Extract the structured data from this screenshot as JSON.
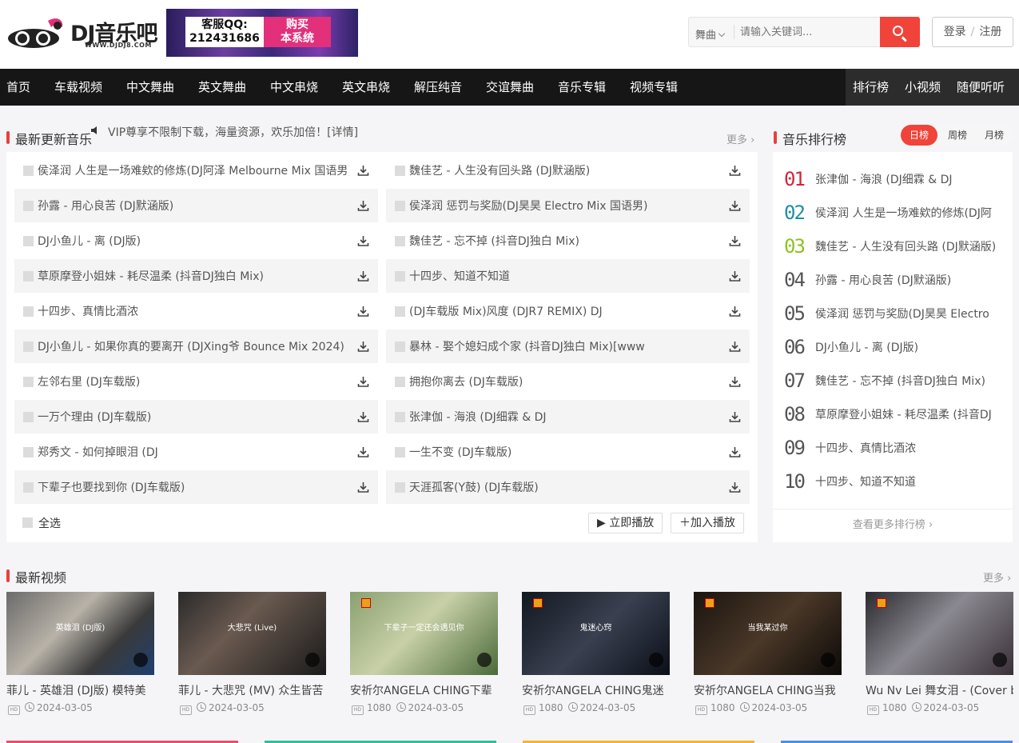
{
  "header": {
    "logo_text": "DJ音乐吧",
    "logo_sub": "WWW.DJDJ8.COM",
    "banner_qq_label": "客服QQ:",
    "banner_qq_number": "212431686",
    "banner_buy_line1": "购买",
    "banner_buy_line2": "本系统",
    "search_category": "舞曲",
    "search_placeholder": "请输入关键词...",
    "login_label": "登录",
    "login_sep": "/",
    "register_label": "注册"
  },
  "nav": {
    "items": [
      "首页",
      "车载视频",
      "中文舞曲",
      "英文舞曲",
      "中文串烧",
      "英文串烧",
      "解压纯音",
      "交谊舞曲",
      "音乐专辑",
      "视频专辑"
    ],
    "right_items": [
      "排行榜",
      "小视频",
      "随便听听"
    ]
  },
  "music": {
    "section_title": "最新更新音乐",
    "notice": "VIP尊享不限制下载，海量资源，欢乐加倍！[详情]",
    "more_label": "更多",
    "left": [
      "侯泽润 人生是一场难欸的修炼(DJ阿泽 Melbourne Mix 国语男)",
      "孙露 - 用心良苦 (DJ默涵版)",
      "DJ小鱼儿 - 离 (DJ版)",
      "草原摩登小姐妹 - 耗尽温柔 (抖音DJ独白 Mix)",
      "十四步、真情比酒浓",
      "DJ小鱼儿 - 如果你真的要离开 (DJXing爷 Bounce Mix 2024)",
      "左邻右里 (DJ车载版)",
      "一万个理由 (DJ车载版)",
      "郑秀文 - 如何掉眼泪 (DJ",
      "下辈子也要找到你 (DJ车载版)"
    ],
    "right": [
      "魏佳艺 - 人生没有回头路 (DJ默涵版)",
      "侯泽润 惩罚与奖励(DJ昊昊 Electro Mix 国语男)",
      "魏佳艺 - 忘不掉 (抖音DJ独白 Mix)",
      "十四步、知道不知道",
      "(DJ车载版 Mix)风度 (DJR7 REMIX) DJ",
      "暴林 - 娶个媳妇成个家 (抖音DJ独白 Mix)[www",
      "拥抱你离去 (DJ车载版)",
      "张津伽 - 海浪 (DJ细霖 & DJ",
      "一生不变 (DJ车载版)",
      "天涯孤客(Y鼓) (DJ车载版)"
    ],
    "select_all": "全选",
    "play_now": "▶ 立即播放",
    "add_play": "＋加入播放"
  },
  "rank": {
    "section_title": "音乐排行榜",
    "tabs": [
      "日榜",
      "周榜",
      "月榜"
    ],
    "active_tab": "日榜",
    "items": [
      {
        "num": "01",
        "name": "张津伽 - 海浪 (DJ细霖 & DJ",
        "color": "#d0263b"
      },
      {
        "num": "02",
        "name": "侯泽润 人生是一场难欸的修炼(DJ阿",
        "color": "#1f8fa3"
      },
      {
        "num": "03",
        "name": "魏佳艺 - 人生没有回头路 (DJ默涵版)",
        "color": "#8fc21f"
      },
      {
        "num": "04",
        "name": "孙露 - 用心良苦 (DJ默涵版)",
        "color": "#555555"
      },
      {
        "num": "05",
        "name": "侯泽润 惩罚与奖励(DJ昊昊 Electro",
        "color": "#555555"
      },
      {
        "num": "06",
        "name": "DJ小鱼儿 - 离 (DJ版)",
        "color": "#555555"
      },
      {
        "num": "07",
        "name": "魏佳艺 - 忘不掉 (抖音DJ独白 Mix)",
        "color": "#555555"
      },
      {
        "num": "08",
        "name": "草原摩登小姐妹 - 耗尽温柔 (抖音DJ",
        "color": "#555555"
      },
      {
        "num": "09",
        "name": "十四步、真情比酒浓",
        "color": "#555555"
      },
      {
        "num": "10",
        "name": "十四步、知道不知道",
        "color": "#555555"
      }
    ],
    "more_label": "查看更多排行榜"
  },
  "videos": {
    "section_title": "最新视频",
    "more_label": "更多",
    "items": [
      {
        "title": "菲儿 - 英雄泪 (DJ版) 模特美",
        "quality": "",
        "date": "2024-03-05",
        "caption": "英雄泪 (DJ版)",
        "bg": "linear-gradient(135deg,#6b6b6b,#b8b2a8 40%,#3a3a3a 70%,#1f3f6f)"
      },
      {
        "title": "菲儿 - 大悲咒 (MV) 众生皆苦",
        "quality": "",
        "date": "2024-03-05",
        "caption": "大悲咒 (Live)",
        "bg": "linear-gradient(135deg,#2a2a2a,#6a5a50 40%,#1a1a1a)"
      },
      {
        "title": "安祈尔ANGELA CHING下辈",
        "quality": "1080",
        "date": "2024-03-05",
        "caption": "下辈子一定还会遇见你",
        "bg": "linear-gradient(135deg,#8aa070,#c8d0a8 45%,#4a6a3a)"
      },
      {
        "title": "安祈尔ANGELA CHING鬼迷",
        "quality": "1080",
        "date": "2024-03-05",
        "caption": "鬼迷心窍",
        "bg": "linear-gradient(135deg,#101820,#3a4050 50%,#0a0f18)"
      },
      {
        "title": "安祈尔ANGELA CHING当我",
        "quality": "1080",
        "date": "2024-03-05",
        "caption": "当我某过你",
        "bg": "linear-gradient(135deg,#1a1410,#4a3828 50%,#0d0a08)"
      },
      {
        "title": "Wu Nv Lei 舞女泪 - (Cover by",
        "quality": "1080",
        "date": "2024-03-05",
        "caption": "",
        "bg": "linear-gradient(135deg,#2a2a30,#8a8890 45%,#3a3038)"
      }
    ]
  },
  "colors": {
    "accent": "#f0433a",
    "nav_bg": "#161616",
    "bottom_strips": [
      "#e8506a",
      "#2fbf9a",
      "#f2b52e",
      "#4a90e2"
    ]
  }
}
